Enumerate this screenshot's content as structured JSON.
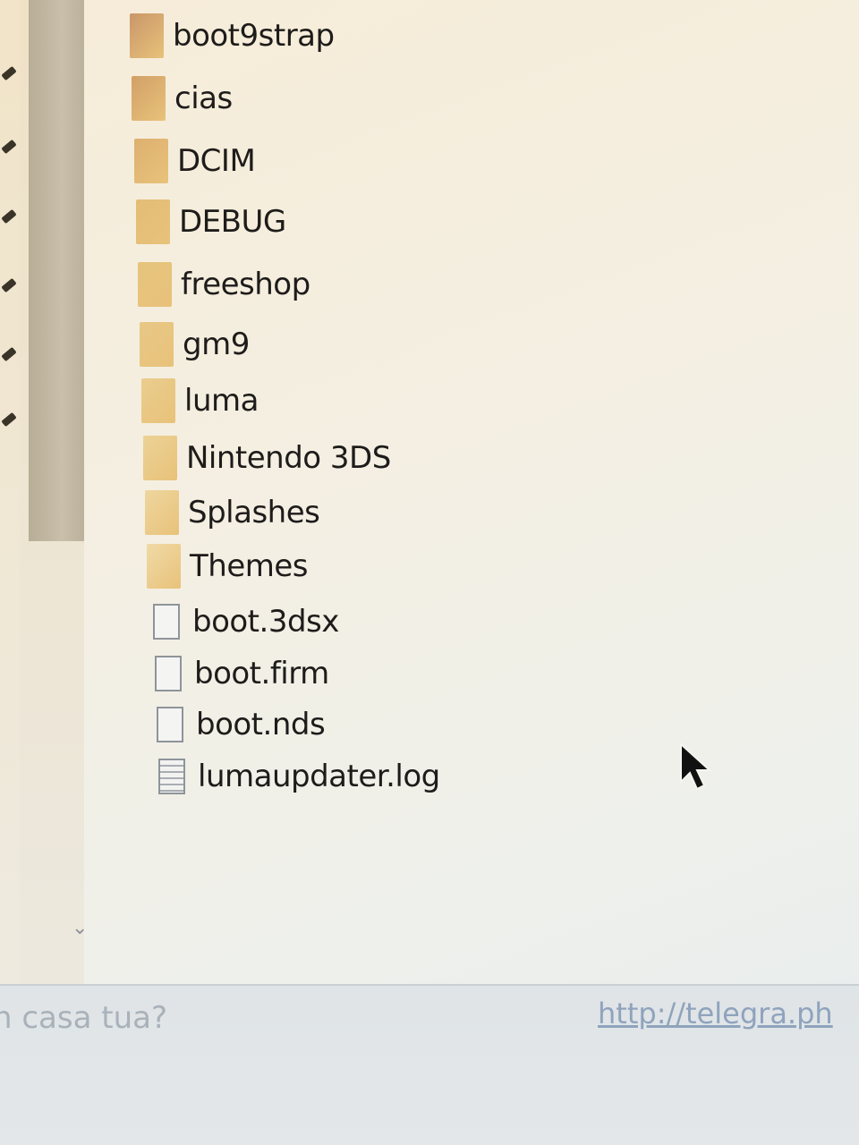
{
  "explorer": {
    "items": [
      {
        "label": "boot9strap",
        "type": "folder",
        "icon": "folder-icon"
      },
      {
        "label": "cias",
        "type": "folder",
        "icon": "folder-icon"
      },
      {
        "label": "DCIM",
        "type": "folder",
        "icon": "folder-icon"
      },
      {
        "label": "DEBUG",
        "type": "folder",
        "icon": "folder-icon"
      },
      {
        "label": "freeshop",
        "type": "folder",
        "icon": "folder-icon"
      },
      {
        "label": "gm9",
        "type": "folder",
        "icon": "folder-icon"
      },
      {
        "label": "luma",
        "type": "folder",
        "icon": "folder-icon"
      },
      {
        "label": "Nintendo 3DS",
        "type": "folder",
        "icon": "folder-icon"
      },
      {
        "label": "Splashes",
        "type": "folder",
        "icon": "folder-icon"
      },
      {
        "label": "Themes",
        "type": "folder",
        "icon": "folder-icon"
      },
      {
        "label": "boot.3dsx",
        "type": "file",
        "icon": "file-icon"
      },
      {
        "label": "boot.firm",
        "type": "file",
        "icon": "file-icon"
      },
      {
        "label": "boot.nds",
        "type": "file",
        "icon": "file-icon"
      },
      {
        "label": "lumaupdater.log",
        "type": "log",
        "icon": "text-file-icon"
      }
    ]
  },
  "background_text": {
    "question": "n casa tua?",
    "link": "http://telegra.ph"
  },
  "colors": {
    "folder": "#e8c27a",
    "text": "#1e1c1a",
    "link": "#8fa3bd"
  }
}
